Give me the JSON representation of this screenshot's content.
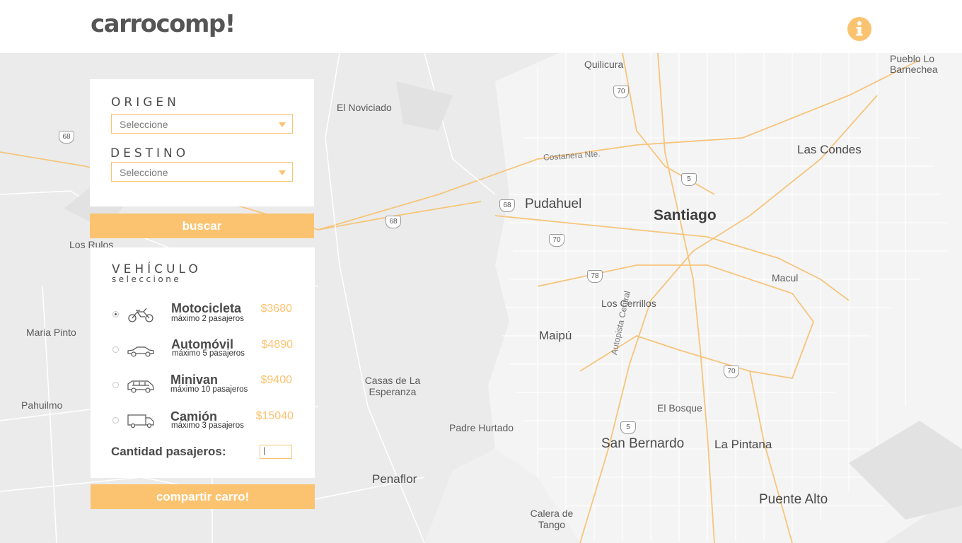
{
  "header": {
    "logo": "carrocomp!",
    "info_icon": "info-icon",
    "accent": "#fbc370"
  },
  "route": {
    "origin_title": "ORIGEN",
    "origin_value": "Seleccione",
    "destination_title": "DESTINO",
    "destination_value": "Seleccione",
    "search_label": "buscar"
  },
  "vehicle": {
    "title": "VEHÍCULO",
    "subtitle": "seleccione",
    "items": [
      {
        "name": "Motocicleta",
        "capacity": "máximo 2 pasajeros",
        "price": "$3680",
        "icon": "motorcycle-icon",
        "selected": true
      },
      {
        "name": "Automóvil",
        "capacity": "máximo 5 pasajeros",
        "price": "$4890",
        "icon": "car-icon",
        "selected": false
      },
      {
        "name": "Minivan",
        "capacity": "máximo 10 pasajeros",
        "price": "$9400",
        "icon": "minivan-icon",
        "selected": false
      },
      {
        "name": "Camión",
        "capacity": "máximo 3 pasajeros",
        "price": "$15040",
        "icon": "truck-icon",
        "selected": false
      }
    ],
    "quantity_label": "Cantidad pasajeros:",
    "quantity_value": "|",
    "share_label": "compartir carro!"
  },
  "map": {
    "places": [
      "Quilicura",
      "Pueblo Lo Barnechea",
      "El Noviciado",
      "Las Condes",
      "Costanera Nte.",
      "Pudahuel",
      "Santiago",
      "Los Rulos",
      "Macul",
      "Los Cerrillos",
      "Maria Pinto",
      "Maipú",
      "Casas de La Esperanza",
      "Autopista Central",
      "El Bosque",
      "Pahuilmo",
      "Padre Hurtado",
      "San Bernardo",
      "La Pintana",
      "Penaflor",
      "Puente Alto",
      "Calera de Tango"
    ],
    "route_shields": [
      "70",
      "68",
      "5",
      "68",
      "68",
      "70",
      "78",
      "70",
      "5"
    ]
  }
}
